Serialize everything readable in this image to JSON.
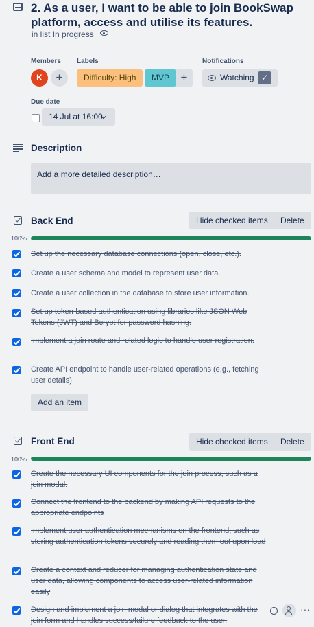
{
  "card": {
    "title": "2. As a user, I want to be able to join BookSwap platform, access and utilise its features.",
    "in_list_prefix": "in list",
    "list_name": "In progress"
  },
  "members": {
    "label": "Members",
    "avatar_initial": "K",
    "add_symbol": "+"
  },
  "labels": {
    "label": "Labels",
    "items": [
      "Difficulty: High",
      "MVP"
    ],
    "add_symbol": "+"
  },
  "notifications": {
    "label": "Notifications",
    "button": "Watching",
    "check": "✓"
  },
  "due_date": {
    "label": "Due date",
    "value": "14 Jul at 16:00"
  },
  "description": {
    "title": "Description",
    "placeholder": "Add a more detailed description…"
  },
  "checklists": [
    {
      "title": "Back End",
      "hide_label": "Hide checked items",
      "delete_label": "Delete",
      "progress_text": "100%",
      "progress": 1.0,
      "items": [
        "Set up the necessary database connections (open, close, etc.).",
        "Create a user schema and model to represent user data.",
        "Create a user collection in the database to store user information.",
        "Set up token-based authentication using libraries like JSON Web Tokens (JWT) and Bcrypt for password hashing.",
        "Implement a join route and related logic to handle user registration.",
        "Create API endpoint to handle user-related operations (e.g., fetching user details)"
      ],
      "add_label": "Add an item"
    },
    {
      "title": "Front End",
      "hide_label": "Hide checked items",
      "delete_label": "Delete",
      "progress_text": "100%",
      "progress": 1.0,
      "items": [
        "Create the necessary UI components for the join process, such as a join modal.",
        "Connect the frontend to the backend by making API requests to the appropriate endpoints",
        "Implement user authentication mechanisms on the frontend, such as storing authentication tokens securely and reading them out upon load",
        "Create a context and reducer for managing authentication state and user data, allowing components to access user-related information easily",
        "Design and implement a join modal or dialog that integrates with the join form and handles success/failure feedback to the user."
      ],
      "more_symbol": "···"
    }
  ],
  "icons": [
    "card-icon",
    "eye-icon",
    "description-icon",
    "checklist-icon",
    "clock-icon",
    "assign-member-icon",
    "more-icon"
  ],
  "colors": {
    "background": "#f1f2f4",
    "progress": "#1f845a",
    "checkbox": "#0c66e4",
    "label_high": "#fbc07e",
    "label_mvp": "#60c6d2",
    "avatar": "#e0441c"
  }
}
